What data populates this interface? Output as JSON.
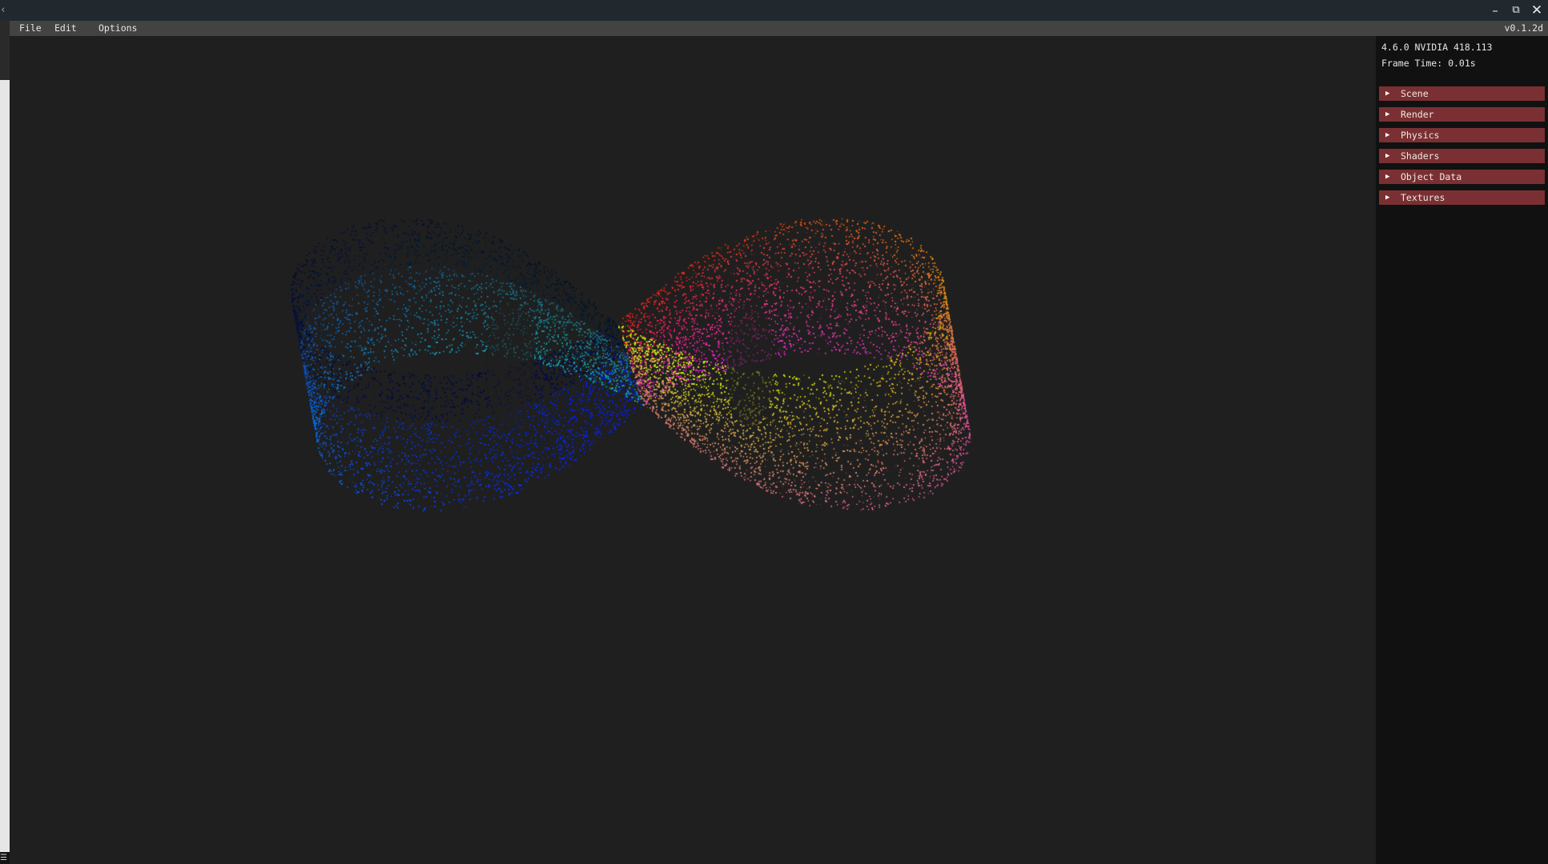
{
  "titlebar": {
    "back_icon": "chevron-left-icon",
    "controls": {
      "minimize": "–",
      "maximize": "⧉",
      "close": "✕"
    }
  },
  "menubar": {
    "items": [
      "File",
      "Edit",
      "Options"
    ],
    "version": "v0.1.2d"
  },
  "info": {
    "gl": "4.6.0 NVIDIA 418.113",
    "frame_time": "Frame Time: 0.01s"
  },
  "panel": {
    "sections": [
      {
        "label": "Scene"
      },
      {
        "label": "Render"
      },
      {
        "label": "Physics"
      },
      {
        "label": "Shaders"
      },
      {
        "label": "Object Data"
      },
      {
        "label": "Textures"
      }
    ],
    "expand_glyph": "▶"
  },
  "colors": {
    "section_bg": "#7a3032",
    "viewport_bg": "#1f1f1f",
    "panel_bg": "#111111",
    "menubar_bg": "#434343",
    "titlebar_bg": "#21292e"
  },
  "scene": {
    "object": "figure-eight point cloud",
    "left_lobe_hues": [
      "cyan",
      "green",
      "blue",
      "black"
    ],
    "right_lobe_hues": [
      "pink",
      "yellow",
      "red",
      "magenta"
    ]
  }
}
